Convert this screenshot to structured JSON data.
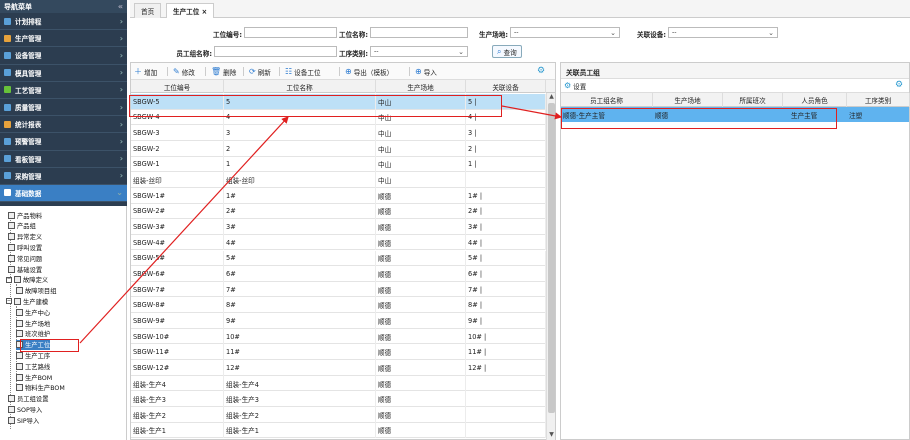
{
  "sidebar": {
    "title": "导航菜单",
    "collapse": "«",
    "menu": [
      {
        "label": "计划排程",
        "color": "#5aa0d8"
      },
      {
        "label": "生产管理",
        "color": "#e6a23c"
      },
      {
        "label": "设备管理",
        "color": "#5aa0d8"
      },
      {
        "label": "模具管理",
        "color": "#5aa0d8"
      },
      {
        "label": "工艺管理",
        "color": "#67c23a"
      },
      {
        "label": "质量管理",
        "color": "#5aa0d8"
      },
      {
        "label": "统计报表",
        "color": "#e6a23c"
      },
      {
        "label": "预警管理",
        "color": "#5aa0d8"
      },
      {
        "label": "看板管理",
        "color": "#5aa0d8"
      },
      {
        "label": "采购管理",
        "color": "#5aa0d8"
      },
      {
        "label": "基础数据",
        "color": "#ffffff"
      }
    ],
    "tree": [
      {
        "label": "产品物料",
        "level": 1
      },
      {
        "label": "产品组",
        "level": 1
      },
      {
        "label": "异常定义",
        "level": 1
      },
      {
        "label": "呼叫设置",
        "level": 1
      },
      {
        "label": "常见问题",
        "level": 1
      },
      {
        "label": "基础设置",
        "level": 1
      },
      {
        "label": "故障定义",
        "level": 0
      },
      {
        "label": "故障项目组",
        "level": 2
      },
      {
        "label": "生产建模",
        "level": 0
      },
      {
        "label": "生产中心",
        "level": 2
      },
      {
        "label": "生产场地",
        "level": 2
      },
      {
        "label": "班次维护",
        "level": 2
      },
      {
        "label": "生产工位",
        "level": 2
      },
      {
        "label": "生产工序",
        "level": 2
      },
      {
        "label": "工艺路线",
        "level": 2
      },
      {
        "label": "生产BOM",
        "level": 2
      },
      {
        "label": "物料生产BOM",
        "level": 2
      },
      {
        "label": "员工组设置",
        "level": 1
      },
      {
        "label": "SOP导入",
        "level": 1
      },
      {
        "label": "SIP导入",
        "level": 1
      }
    ]
  },
  "tabs": [
    {
      "label": "首页"
    },
    {
      "label": "生产工位 ×"
    }
  ],
  "filter": {
    "station_code_label": "工位编号:",
    "station_name_label": "工位名称:",
    "site_label": "生产场地:",
    "site_value": "--",
    "device_label": "关联设备:",
    "device_value": "--",
    "group_name_label": "员工组名称:",
    "process_type_label": "工序类别:",
    "process_type_value": "--",
    "query_label": "查询"
  },
  "toolbar": {
    "add": "增加",
    "edit": "修改",
    "delete": "删除",
    "refresh": "刷新",
    "device_station": "设备工位",
    "export": "导出（模板）",
    "import": "导入"
  },
  "grid": {
    "columns": [
      "工位编号",
      "工位名称",
      "生产场地",
      "关联设备"
    ],
    "rows": [
      [
        "SBGW-5",
        "5",
        "中山",
        "5 |"
      ],
      [
        "SBGW-4",
        "4",
        "中山",
        "4 |"
      ],
      [
        "SBGW-3",
        "3",
        "中山",
        "3 |"
      ],
      [
        "SBGW-2",
        "2",
        "中山",
        "2 |"
      ],
      [
        "SBGW-1",
        "1",
        "中山",
        "1 |"
      ],
      [
        "组装-丝印",
        "组装-丝印",
        "中山",
        ""
      ],
      [
        "SBGW-1#",
        "1#",
        "顺德",
        "1# |"
      ],
      [
        "SBGW-2#",
        "2#",
        "顺德",
        "2# |"
      ],
      [
        "SBGW-3#",
        "3#",
        "顺德",
        "3# |"
      ],
      [
        "SBGW-4#",
        "4#",
        "顺德",
        "4# |"
      ],
      [
        "SBGW-5#",
        "5#",
        "顺德",
        "5# |"
      ],
      [
        "SBGW-6#",
        "6#",
        "顺德",
        "6# |"
      ],
      [
        "SBGW-7#",
        "7#",
        "顺德",
        "7# |"
      ],
      [
        "SBGW-8#",
        "8#",
        "顺德",
        "8# |"
      ],
      [
        "SBGW-9#",
        "9#",
        "顺德",
        "9# |"
      ],
      [
        "SBGW-10#",
        "10#",
        "顺德",
        "10# |"
      ],
      [
        "SBGW-11#",
        "11#",
        "顺德",
        "11# |"
      ],
      [
        "SBGW-12#",
        "12#",
        "顺德",
        "12# |"
      ],
      [
        "组装-生产4",
        "组装-生产4",
        "顺德",
        ""
      ],
      [
        "组装-生产3",
        "组装-生产3",
        "顺德",
        ""
      ],
      [
        "组装-生产2",
        "组装-生产2",
        "顺德",
        ""
      ],
      [
        "组装-生产1",
        "组装-生产1",
        "顺德",
        ""
      ]
    ]
  },
  "right_panel": {
    "title": "关联员工组",
    "settings": "设置",
    "columns": [
      "员工组名称",
      "生产场地",
      "所属班次",
      "人员角色",
      "工序类别"
    ],
    "rows": [
      [
        "顺德-生产主管",
        "顺德",
        "",
        "生产主管",
        "注塑"
      ]
    ]
  },
  "colors": {
    "sidebar_bg": "#2c3d50",
    "accent": "#3a7fc4",
    "selected_row": "#bde0f7",
    "right_selected_row": "#5fb3ef",
    "annotation": "#e02020"
  }
}
